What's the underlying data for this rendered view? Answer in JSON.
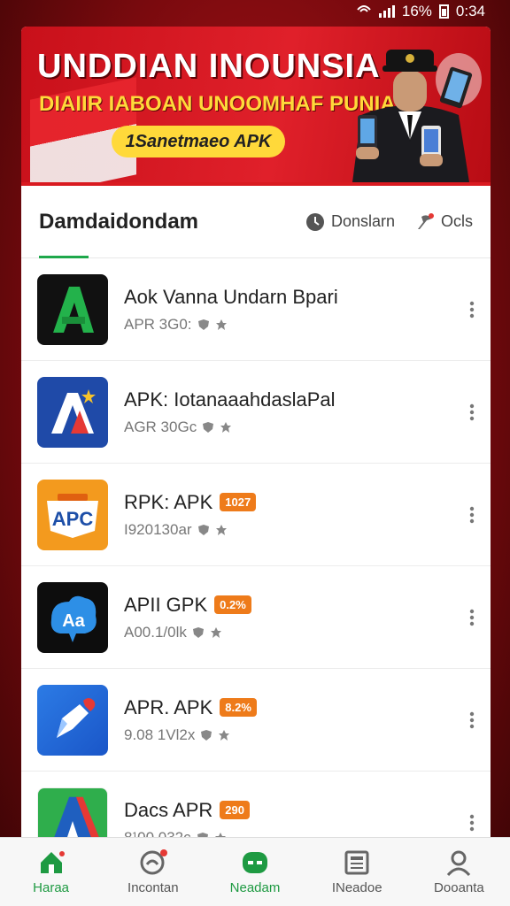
{
  "status_bar": {
    "battery": "16%",
    "time": "0:34"
  },
  "banner": {
    "title": "UNDDIAN INOUNSIA",
    "subtitle": "DIAIIR IABOAN UNOOMHAF PUNIAN",
    "cta": "1Sanetmaeo APK"
  },
  "header": {
    "tab_label": "Damdaidondam",
    "action_1": "Donslarn",
    "action_2": "Ocls"
  },
  "apps": [
    {
      "name": "Aok Vanna Undarn Bpari",
      "meta": "APR 3G0:",
      "badge": "",
      "icon": "green-a-icon"
    },
    {
      "name": "APK: IotanaaahdaslaPal",
      "meta": "AGR 30Gc",
      "badge": "",
      "icon": "blue-a-icon"
    },
    {
      "name": "RPK: APK",
      "meta": "I920130ar",
      "badge": "1027",
      "icon": "apc-icon"
    },
    {
      "name": "APII GPK",
      "meta": "A00.1/0lk",
      "badge": "0.2%",
      "icon": "aa-icon"
    },
    {
      "name": "APR. APK",
      "meta": "9.08 1Vl2x",
      "badge": "8.2%",
      "icon": "pen-icon"
    },
    {
      "name": "Dacs APR",
      "meta": "8¹00 032c",
      "badge": "290",
      "icon": "tri-a-icon"
    }
  ],
  "bottom_nav": [
    {
      "label": "Haraa",
      "icon": "home-icon",
      "active": true
    },
    {
      "label": "Incontan",
      "icon": "chat-icon",
      "active": false
    },
    {
      "label": "Neadam",
      "icon": "apps-icon",
      "active": false
    },
    {
      "label": "INeadoe",
      "icon": "news-icon",
      "active": false
    },
    {
      "label": "Dooanta",
      "icon": "profile-icon",
      "active": false
    }
  ],
  "colors": {
    "accent": "#1e9a42",
    "banner_red": "#d91a20",
    "badge_orange": "#ee7b1a"
  }
}
